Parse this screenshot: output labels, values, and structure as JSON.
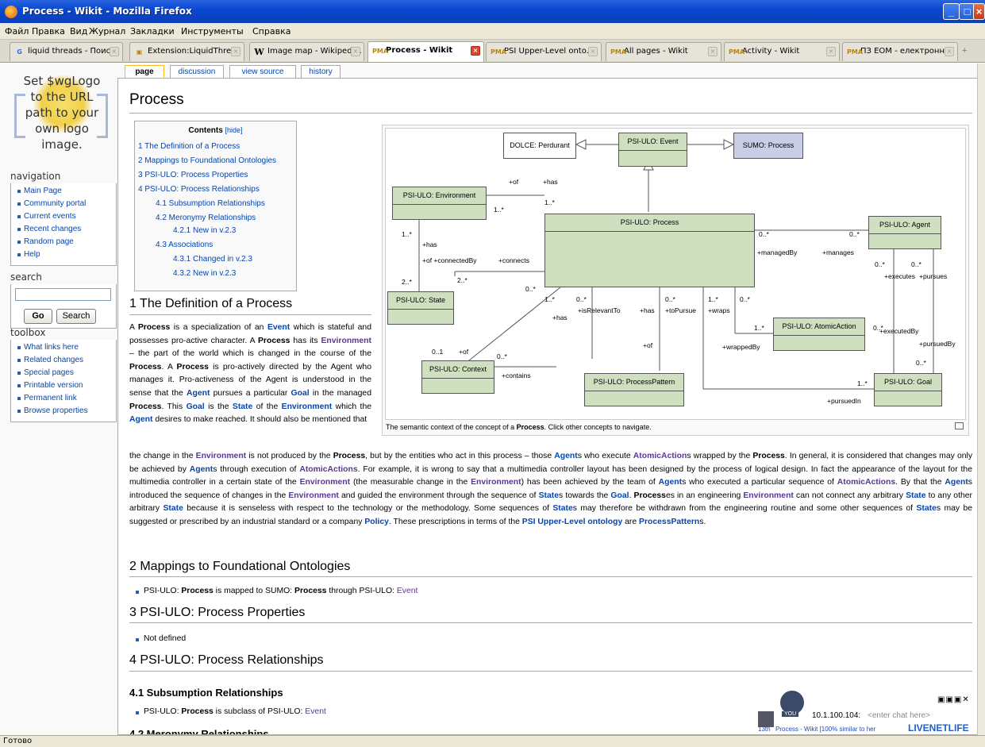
{
  "window": {
    "title": "Process - Wikit - Mozilla Firefox"
  },
  "menu": [
    "Файл",
    "Правка",
    "Вид",
    "Журнал",
    "Закладки",
    "Инструменты",
    "Справка"
  ],
  "tabs": [
    {
      "label": "liquid threads - Поис...",
      "icon": "google-icon"
    },
    {
      "label": "Extension:LiquidThre...",
      "icon": "wiki-icon"
    },
    {
      "label": "Image map - Wikipedi...",
      "icon": "wikipedia-icon"
    },
    {
      "label": "Process - Wikit",
      "icon": "pma-icon",
      "active": true
    },
    {
      "label": "PSI Upper-Level onto...",
      "icon": "pma-icon"
    },
    {
      "label": "All pages - Wikit",
      "icon": "pma-icon"
    },
    {
      "label": "Activity - Wikit",
      "icon": "pma-icon"
    },
    {
      "label": "ПЗ ЕОМ - електронн...",
      "icon": "pma-icon"
    }
  ],
  "status": "Готово",
  "sidebar": {
    "logo_text": [
      "Set $wgLogo",
      "to the URL",
      "path to your",
      "own logo",
      "image."
    ],
    "navigation_title": "navigation",
    "navigation": [
      "Main Page",
      "Community portal",
      "Current events",
      "Recent changes",
      "Random page",
      "Help"
    ],
    "search_title": "search",
    "go": "Go",
    "search": "Search",
    "toolbox_title": "toolbox",
    "toolbox": [
      "What links here",
      "Related changes",
      "Special pages",
      "Printable version",
      "Permanent link",
      "Browse properties"
    ]
  },
  "page_tabs": [
    "page",
    "discussion",
    "view source",
    "history"
  ],
  "article": {
    "title": "Process",
    "toc_title": "Contents",
    "toc_hide": "[hide]",
    "toc": [
      "1 The Definition of a Process",
      "2 Mappings to Foundational Ontologies",
      "3 PSI-ULO: Process Properties",
      "4 PSI-ULO: Process Relationships",
      "4.1 Subsumption Relationships",
      "4.2 Meronymy Relationships",
      "4.2.1 New in v.2.3",
      "4.3 Associations",
      "4.3.1 Changed in v.2.3",
      "4.3.2 New in v.2.3"
    ],
    "h_def": "1 The Definition of a Process",
    "h_map": "2 Mappings to Foundational Ontologies",
    "map_item_a": "PSI-ULO: ",
    "map_item_b": "Process",
    "map_item_c": " is mapped to SUMO: ",
    "map_item_d": "Process",
    "map_item_e": " through PSI-ULO: ",
    "map_item_f": "Event",
    "h_props": "3 PSI-ULO: Process Properties",
    "props_item": "Not defined",
    "h_rels": "4 PSI-ULO: Process Relationships",
    "h_sub": "4.1 Subsumption Relationships",
    "sub_item_a": "PSI-ULO: ",
    "sub_item_b": "Process",
    "sub_item_c": " is subclass of PSI-ULO: ",
    "sub_item_d": "Event",
    "h_mero": "4.2 Meronymy Relationships",
    "caption_a": "The semantic context of the concept of a ",
    "caption_b": "Process",
    "caption_c": ". Click other concepts to navigate."
  },
  "diagram": {
    "boxes": [
      "DOLCE: Perdurant",
      "PSI-ULO: Event",
      "SUMO: Process",
      "PSI-ULO: Environment",
      "PSI-ULO: Process",
      "PSI-ULO: Agent",
      "PSI-ULO: State",
      "PSI-ULO: AtomicAction",
      "PSI-ULO: Context",
      "PSI-ULO: ProcessPattern",
      "PSI-ULO: Goal"
    ],
    "labels": [
      "+of",
      "+has",
      "1..*",
      "1..*",
      "1..*",
      "+has",
      "+of +connectedBy",
      "+connects",
      "2..*",
      "2..*",
      "0..*",
      "0..*",
      "0..*",
      "+managedBy",
      "+manages",
      "0..*",
      "0..*",
      "+executes",
      "+pursues",
      "1..*",
      "0..*",
      "+isRelevantTo",
      "+has",
      "0..*",
      "+toPursue",
      "1..*",
      "+wraps",
      "0..*",
      "+has",
      "1..*",
      "0..*",
      "+executedBy",
      "+wrappedBy",
      "+of",
      "0..1",
      "+of",
      "0..*",
      "+contains",
      "+pursuedBy",
      "0..*",
      "1..*",
      "+pursuedIn"
    ]
  },
  "chat": {
    "ip": "10.1.100.104:",
    "placeholder": "<enter chat here>",
    "you": "YOU",
    "rank": "13th",
    "status": "Process - Wikit [100% similar to her",
    "brand": "LIVENETLIFE"
  }
}
